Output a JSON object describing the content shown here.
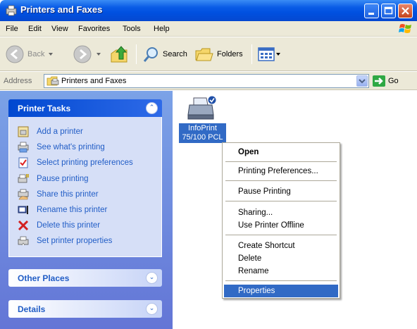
{
  "window": {
    "title": "Printers and Faxes"
  },
  "menubar": {
    "items": [
      "File",
      "Edit",
      "View",
      "Favorites",
      "Tools",
      "Help"
    ]
  },
  "toolbar": {
    "back_label": "Back",
    "search_label": "Search",
    "folders_label": "Folders"
  },
  "addressbar": {
    "label": "Address",
    "value": "Printers and Faxes",
    "go_label": "Go"
  },
  "taskpane": {
    "printer_tasks": {
      "title": "Printer Tasks",
      "items": [
        {
          "label": "Add a printer",
          "icon": "add-printer-icon"
        },
        {
          "label": "See what's printing",
          "icon": "print-queue-icon"
        },
        {
          "label": "Select printing preferences",
          "icon": "preferences-icon"
        },
        {
          "label": "Pause printing",
          "icon": "pause-printer-icon"
        },
        {
          "label": "Share this printer",
          "icon": "share-printer-icon"
        },
        {
          "label": "Rename this printer",
          "icon": "rename-icon"
        },
        {
          "label": "Delete this printer",
          "icon": "delete-icon"
        },
        {
          "label": "Set printer properties",
          "icon": "printer-properties-icon"
        }
      ]
    },
    "other_places": {
      "title": "Other Places"
    },
    "details": {
      "title": "Details"
    }
  },
  "content": {
    "printer": {
      "label_line1": "InfoPrint",
      "label_line2": "75/100 PCL"
    }
  },
  "context_menu": {
    "items": [
      {
        "label": "Open",
        "bold": true
      },
      {
        "label": "Printing Preferences..."
      },
      {
        "label": "Pause Printing"
      },
      {
        "label": "Sharing..."
      },
      {
        "label": "Use Printer Offline"
      },
      {
        "label": "Create Shortcut"
      },
      {
        "label": "Delete"
      },
      {
        "label": "Rename"
      },
      {
        "label": "Properties",
        "selected": true
      }
    ]
  },
  "colors": {
    "titlebar": "#0a5ce6",
    "task_link": "#215dc6",
    "selection": "#316ac5",
    "pane_bg": "#7ba2e7"
  }
}
